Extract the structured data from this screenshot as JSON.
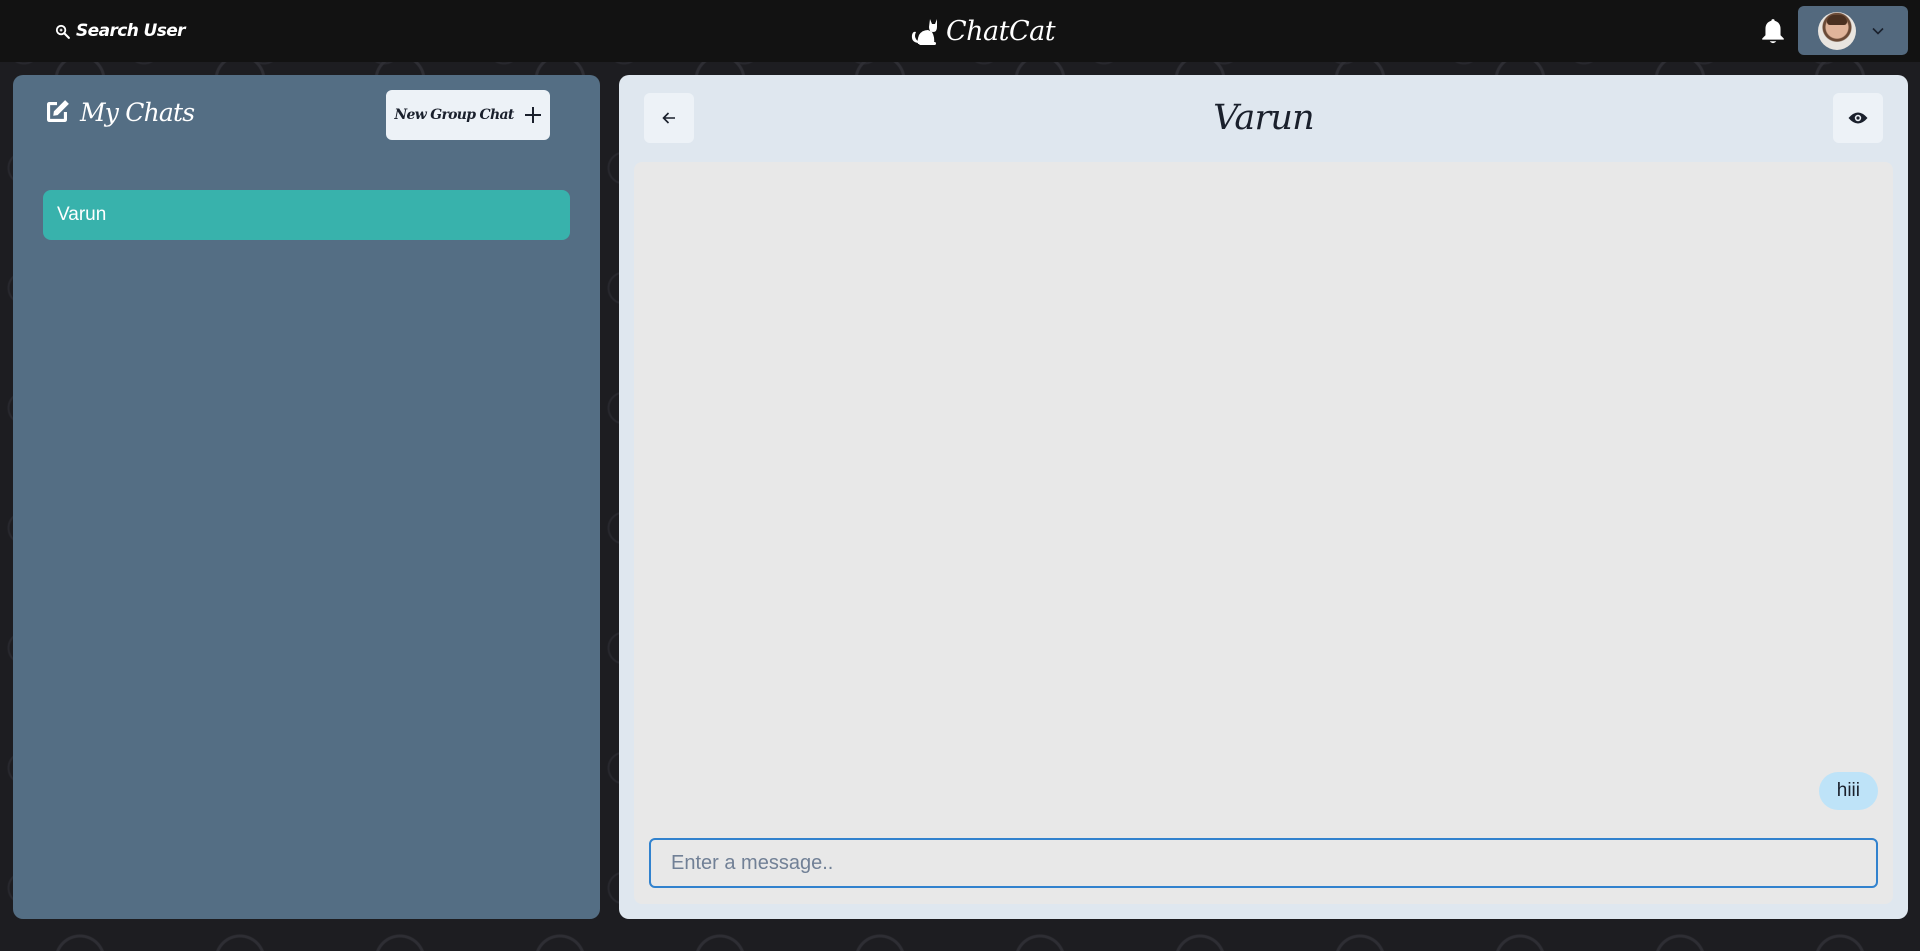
{
  "topbar": {
    "search_label": "Search User",
    "brand": "ChatCat"
  },
  "left_panel": {
    "title": "My Chats",
    "new_group_label": "New Group Chat",
    "chats": [
      {
        "name": "Varun",
        "selected": true
      }
    ]
  },
  "chat": {
    "title": "Varun",
    "messages": [
      {
        "text": "hiii",
        "from_me": true
      }
    ],
    "input_placeholder": "Enter a message.."
  },
  "colors": {
    "navbar": "#121212",
    "left_panel": "#546e84",
    "selected_chat": "#38b2ac",
    "right_panel": "#dfe7ef",
    "message_bubble": "#bee3f8",
    "input_border": "#3182ce"
  },
  "icons": {
    "search": "magnifier-icon",
    "brand": "cat-icon",
    "bell": "bell-icon",
    "edit": "edit-square-icon",
    "plus": "plus-icon",
    "back": "arrow-left-icon",
    "eye": "eye-icon",
    "chevron": "chevron-down-icon"
  }
}
